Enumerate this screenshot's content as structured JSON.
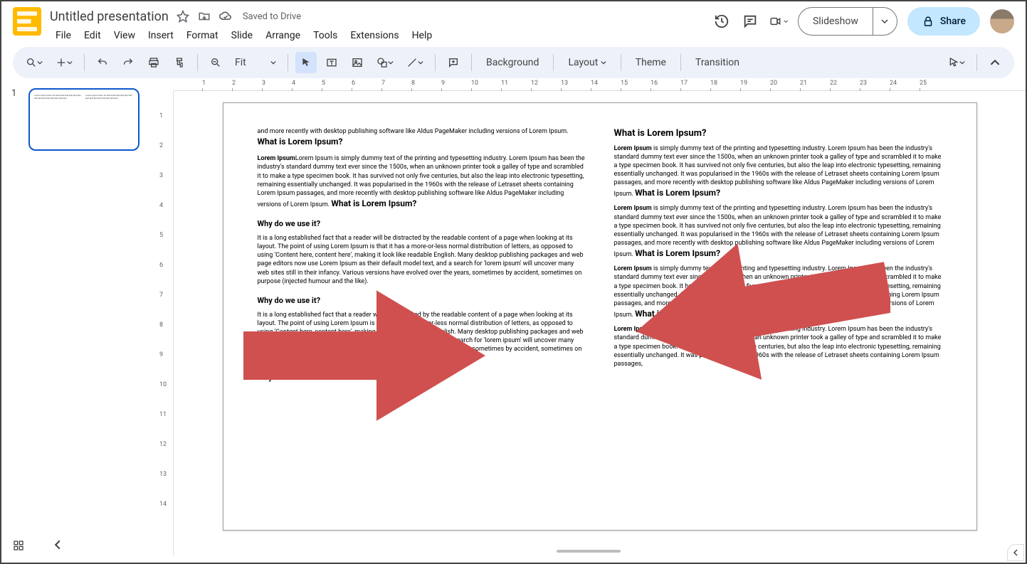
{
  "header": {
    "doc_title": "Untitled presentation",
    "saved_status": "Saved to Drive",
    "menus": [
      "File",
      "Edit",
      "View",
      "Insert",
      "Format",
      "Slide",
      "Arrange",
      "Tools",
      "Extensions",
      "Help"
    ],
    "slideshow_label": "Slideshow",
    "share_label": "Share"
  },
  "toolbar": {
    "zoom_label": "Fit",
    "buttons": {
      "background": "Background",
      "layout": "Layout",
      "theme": "Theme",
      "transition": "Transition"
    }
  },
  "filmstrip": {
    "slide_number": "1"
  },
  "ruler_h": [
    "1",
    "2",
    "3",
    "4",
    "5",
    "6",
    "7",
    "8",
    "9",
    "10",
    "11",
    "12",
    "13",
    "14",
    "15",
    "16",
    "17",
    "18",
    "19",
    "20",
    "21",
    "22",
    "23",
    "24",
    "25"
  ],
  "ruler_v": [
    "1",
    "2",
    "3",
    "4",
    "5",
    "6",
    "7",
    "8",
    "9",
    "10",
    "11",
    "12",
    "13",
    "14"
  ],
  "slide": {
    "left": {
      "intro_tail": "and more recently with desktop publishing software like Aldus PageMaker including versions of Lorem Ipsum.",
      "h_what": "What is Lorem Ipsum?",
      "p_what": "Lorem Ipsum is simply dummy text of the printing and typesetting industry. Lorem Ipsum has been the industry's standard dummy text ever since the 1500s, when an unknown printer took a galley of type and scrambled it to make a type specimen book. It has survived not only five centuries, but also the leap into electronic typesetting, remaining essentially unchanged. It was popularised in the 1960s with the release of Letraset sheets containing Lorem Ipsum passages, and more recently with desktop publishing software like Aldus PageMaker including versions of Lorem Ipsum.",
      "h_what2": "What is Lorem Ipsum?",
      "h_why1": "Why do we use it?",
      "p_why1": "It is a long established fact that a reader will be distracted by the readable content of a page when looking at its layout. The point of using Lorem Ipsum is that it has a more-or-less normal distribution of letters, as opposed to using 'Content here, content here', making it look like readable English. Many desktop publishing packages and web page editors now use Lorem Ipsum as their default model text, and a search for 'lorem ipsum' will uncover many web sites still in their infancy. Various versions have evolved over the years, sometimes by accident, sometimes on purpose (injected humour and the like).",
      "h_why2": "Why do we use it?",
      "p_why2": "It is a long established fact that a reader will be distracted by the readable content of a page when looking at its layout. The point of using Lorem Ipsum is that it has a more-or-less normal distribution of letters, as opposed to using 'Content here, content here', making it look like readable English. Many desktop publishing packages and web page editors now use Lorem Ipsum as their default model text, and a search for 'lorem ipsum' will uncover many web sites still in their infancy. Various versions have evolved over the years, sometimes by accident, sometimes on purpose (injected humour and the like).",
      "h_why3": "Why do we use it?"
    },
    "right": {
      "h1": "What is Lorem Ipsum?",
      "lead": "Lorem Ipsum",
      "p1": " is simply dummy text of the printing and typesetting industry. Lorem Ipsum has been the industry's standard dummy text ever since the 1500s, when an unknown printer took a galley of type and scrambled it to make a type specimen book. It has survived not only five centuries, but also the leap into electronic typesetting, remaining essentially unchanged. It was popularised in the 1960s with the release of Letraset sheets containing Lorem Ipsum passages, and more recently with desktop publishing software like Aldus PageMaker including versions of Lorem Ipsum.",
      "h2": "What is Lorem Ipsum?",
      "p2": " is simply dummy text of the printing and typesetting industry. Lorem Ipsum has been the industry's standard dummy text ever since the 1500s, when an unknown printer took a galley of type and scrambled it to make a type specimen book. It has survived not only five centuries, but also the leap into electronic typesetting, remaining essentially unchanged. It was popularised in the 1960s with the release of Letraset sheets containing Lorem Ipsum passages, and more recently with desktop publishing software like Aldus PageMaker including versions of Lorem Ipsum.",
      "h3": "What is Lorem Ipsum?",
      "p3": " is simply dummy text of the printing and typesetting industry. Lorem Ipsum has been the industry's standard dummy text ever since the 1500s, when an unknown printer took a galley of type and scrambled it to make a type specimen book. It has survived not only five centuries, but also the leap into electronic typesetting, remaining essentially unchanged. It was popularised in the 1960s with the release of Letraset sheets containing Lorem Ipsum passages, and more recently with desktop publishing software like Aldus PageMaker including versions of Lorem Ipsum.",
      "h4": "What is Lorem Ipsum?",
      "p4": " is simply dummy text of the printing and typesetting industry. Lorem Ipsum has been the industry's standard dummy text ever since the 1500s, when an unknown printer took a galley of type and scrambled it to make a type specimen book. It has survived not only five centuries, but also the leap into electronic typesetting, remaining essentially unchanged. It was popularised in the 1960s with the release of Letraset sheets containing Lorem Ipsum passages,"
    }
  }
}
